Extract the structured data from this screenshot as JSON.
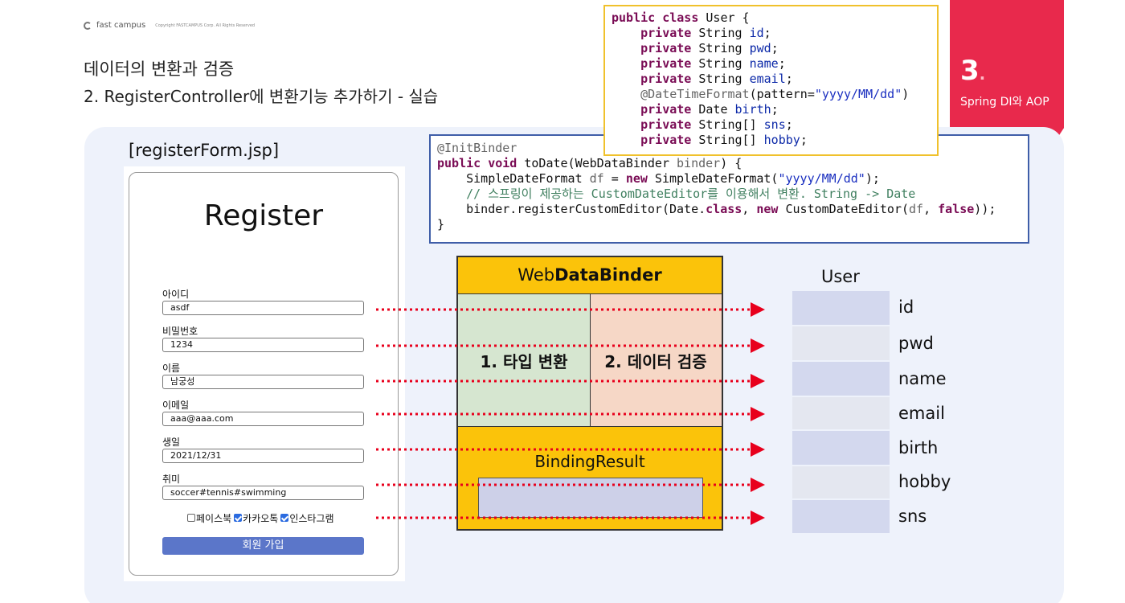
{
  "header": {
    "brand": "fast campus",
    "copyright": "Copyright FASTCAMPUS Corp. All Rights Reserved",
    "title_line1": "데이터의 변환과 검증",
    "title_line2": "2. RegisterController에 변환기능 추가하기 - 실습"
  },
  "section": {
    "number": "3",
    "dot": ".",
    "title": "Spring DI와 AOP"
  },
  "colors": {
    "accent_red": "#e8294c",
    "binder_yellow": "#fbc30a",
    "conversion_green": "#d6e6d0",
    "validation_pink": "#f6d7c6",
    "button_blue": "#5b76c9",
    "arrow_red": "#e8001c"
  },
  "form": {
    "caption": "[registerForm.jsp]",
    "title": "Register",
    "fields": [
      {
        "label": "아이디",
        "value": "asdf"
      },
      {
        "label": "비밀번호",
        "value": "1234"
      },
      {
        "label": "이름",
        "value": "남궁성"
      },
      {
        "label": "이메일",
        "value": "aaa@aaa.com"
      },
      {
        "label": "생일",
        "value": "2021/12/31"
      },
      {
        "label": "취미",
        "value": "soccer#tennis#swimming"
      }
    ],
    "checkboxes": [
      {
        "label": "페이스북",
        "checked": false
      },
      {
        "label": "카카오톡",
        "checked": true
      },
      {
        "label": "인스타그램",
        "checked": true
      }
    ],
    "submit_label": "회원 가입"
  },
  "code_user": {
    "line1_kw": "public class",
    "line1_rest": " User {",
    "fields": [
      {
        "kw": "private",
        "type": " String ",
        "name": "id",
        "end": ";"
      },
      {
        "kw": "private",
        "type": " String ",
        "name": "pwd",
        "end": ";"
      },
      {
        "kw": "private",
        "type": " String ",
        "name": "name",
        "end": ";"
      },
      {
        "kw": "private",
        "type": " String ",
        "name": "email",
        "end": ";"
      }
    ],
    "annotation": "@DateTimeFormat",
    "annotation_arg": "(pattern=",
    "annotation_str": "\"yyyy/MM/dd\"",
    "annotation_end": ")",
    "fields2": [
      {
        "kw": "private",
        "type": " Date ",
        "name": "birth",
        "end": ";"
      },
      {
        "kw": "private",
        "type": " String[] ",
        "name": "sns",
        "end": ";"
      },
      {
        "kw": "private",
        "type": " String[] ",
        "name": "hobby",
        "end": ";"
      }
    ],
    "close": "}"
  },
  "code_binder": {
    "annotation": "@InitBinder",
    "sig_kw1": "public void",
    "sig_rest1": " toDate(WebDataBinder ",
    "sig_param": "binder",
    "sig_rest2": ") {",
    "l3_a": "    SimpleDateFormat ",
    "l3_var": "df",
    "l3_b": " = ",
    "l3_kw": "new",
    "l3_c": " SimpleDateFormat(",
    "l3_str": "\"yyyy/MM/dd\"",
    "l3_d": ");",
    "comment": "    // 스프링이 제공하는 CustomDateEditor를 이용해서 변환. String -> Date",
    "l5_a": "    binder.registerCustomEditor(Date.",
    "l5_kw1": "class",
    "l5_b": ", ",
    "l5_kw2": "new",
    "l5_c": " CustomDateEditor(",
    "l5_var": "df",
    "l5_d": ", ",
    "l5_kw3": "false",
    "l5_e": "));",
    "close": "}"
  },
  "binder": {
    "title_prefix": "Web",
    "title_bold": "DataBinder",
    "conversion_label": "1. 타입 변환",
    "validation_label": "2. 데이터 검증",
    "binding_result": "BindingResult"
  },
  "user_object": {
    "title": "User",
    "properties": [
      "id",
      "pwd",
      "name",
      "email",
      "birth",
      "hobby",
      "sns"
    ]
  }
}
